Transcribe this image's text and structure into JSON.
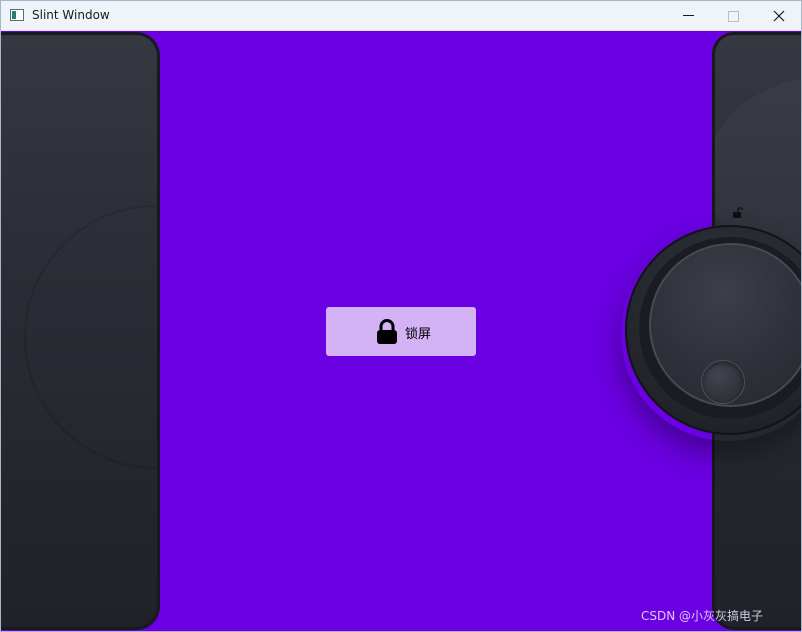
{
  "window": {
    "title": "Slint Window",
    "minimize_icon": "minimize-icon",
    "maximize_icon": "maximize-icon",
    "close_icon": "close-icon"
  },
  "main": {
    "background_color": "#6b00e3",
    "lock_button": {
      "label": "锁屏",
      "icon": "lock-icon",
      "color": "#d3b3f6"
    },
    "knob": {
      "indicator_icon": "unlock-icon"
    }
  },
  "watermark": "CSDN @小灰灰搞电子"
}
